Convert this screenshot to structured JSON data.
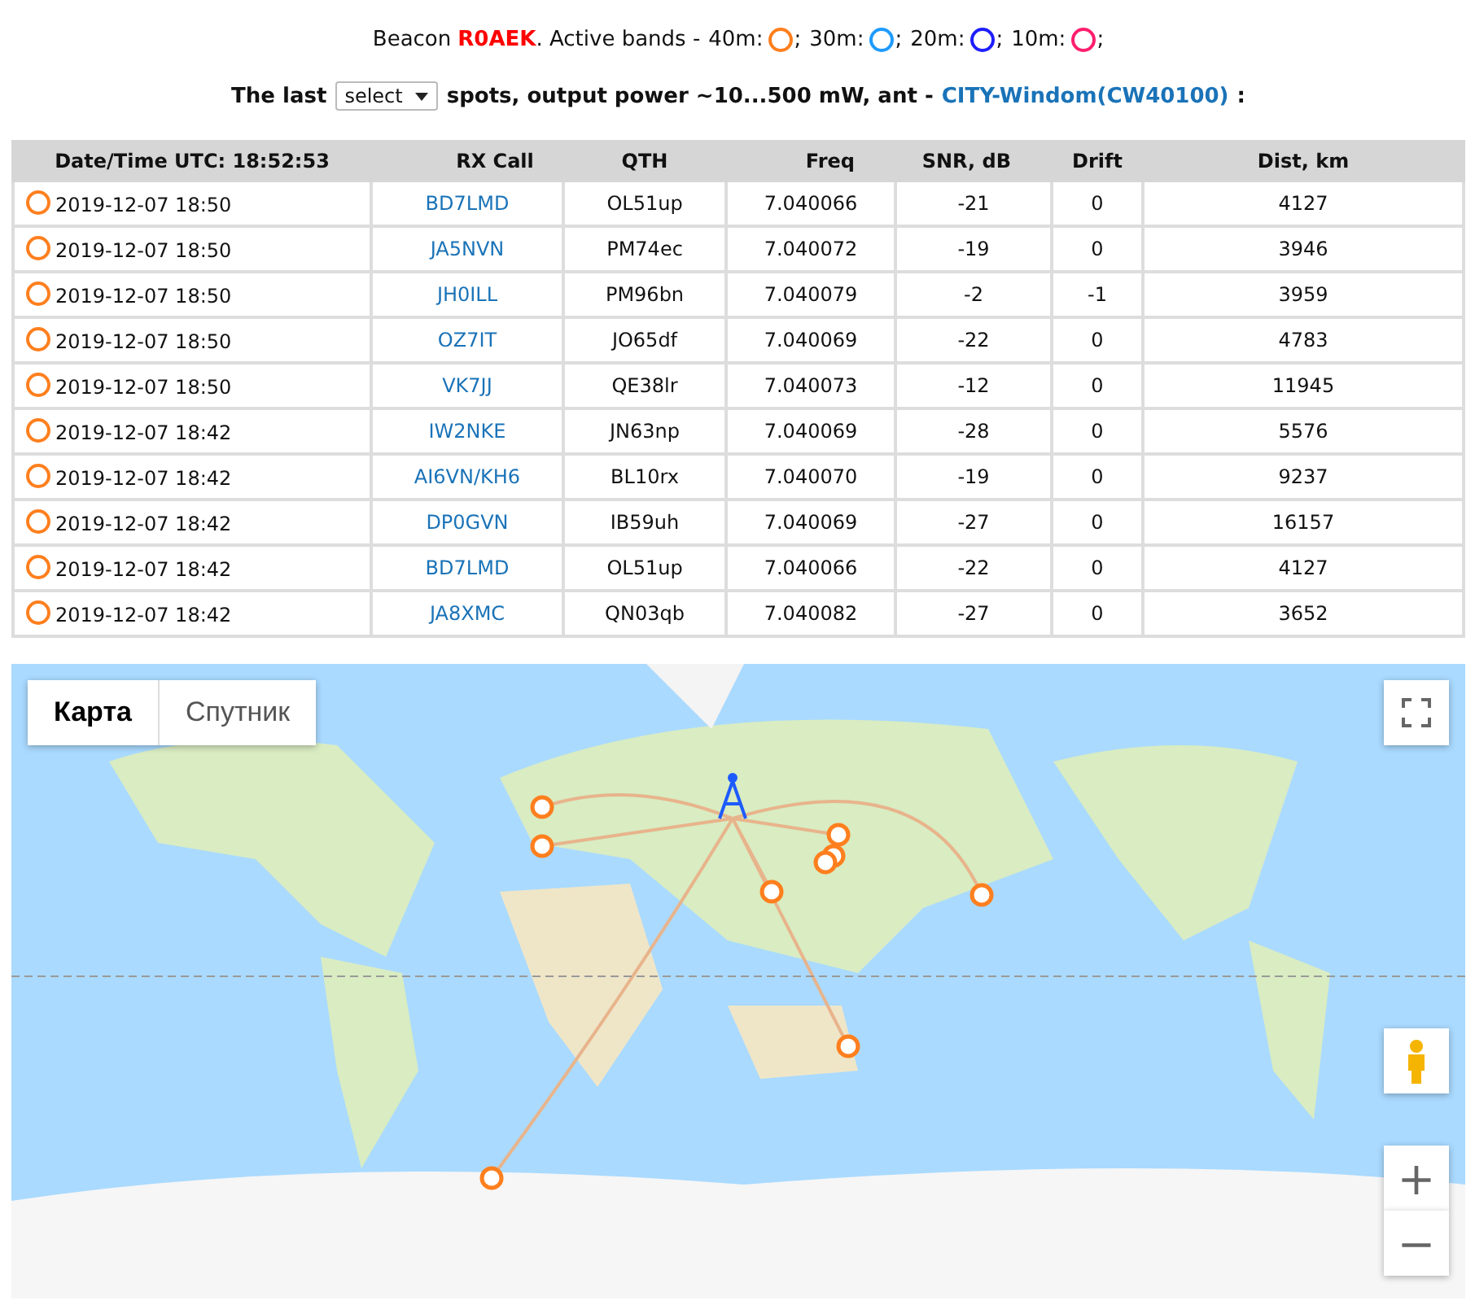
{
  "beacon": {
    "prefix": "Beacon",
    "call": "R0AEK",
    "mid": ". Active bands -"
  },
  "bands": [
    {
      "label": "40m:",
      "color": "#ff7f1e",
      "sep": ";"
    },
    {
      "label": "30m:",
      "color": "#1e9bff",
      "sep": ";"
    },
    {
      "label": "20m:",
      "color": "#1e1eff",
      "sep": ";"
    },
    {
      "label": "10m:",
      "color": "#ff1e6e",
      "sep": ";"
    }
  ],
  "spots_line": {
    "before": "The last",
    "select": "select",
    "after": "spots, output power ~10...500 mW, ant -",
    "antenna": "CITY-Windom(CW40100)",
    "end": ":"
  },
  "table": {
    "columns": [
      "Date/Time UTC: 18:52:53",
      "RX Call",
      "QTH",
      "Freq",
      "SNR, dB",
      "Drift",
      "Dist, km"
    ],
    "rows": [
      {
        "color": "#ff7f1e",
        "time": "2019-12-07 18:50",
        "call": "BD7LMD",
        "qth": "OL51up",
        "freq": "7.040066",
        "snr": "-21",
        "drift": "0",
        "dist": "4127"
      },
      {
        "color": "#ff7f1e",
        "time": "2019-12-07 18:50",
        "call": "JA5NVN",
        "qth": "PM74ec",
        "freq": "7.040072",
        "snr": "-19",
        "drift": "0",
        "dist": "3946"
      },
      {
        "color": "#ff7f1e",
        "time": "2019-12-07 18:50",
        "call": "JH0ILL",
        "qth": "PM96bn",
        "freq": "7.040079",
        "snr": "-2",
        "drift": "-1",
        "dist": "3959"
      },
      {
        "color": "#ff7f1e",
        "time": "2019-12-07 18:50",
        "call": "OZ7IT",
        "qth": "JO65df",
        "freq": "7.040069",
        "snr": "-22",
        "drift": "0",
        "dist": "4783"
      },
      {
        "color": "#ff7f1e",
        "time": "2019-12-07 18:50",
        "call": "VK7JJ",
        "qth": "QE38lr",
        "freq": "7.040073",
        "snr": "-12",
        "drift": "0",
        "dist": "11945"
      },
      {
        "color": "#ff7f1e",
        "time": "2019-12-07 18:42",
        "call": "IW2NKE",
        "qth": "JN63np",
        "freq": "7.040069",
        "snr": "-28",
        "drift": "0",
        "dist": "5576"
      },
      {
        "color": "#ff7f1e",
        "time": "2019-12-07 18:42",
        "call": "AI6VN/KH6",
        "qth": "BL10rx",
        "freq": "7.040070",
        "snr": "-19",
        "drift": "0",
        "dist": "9237"
      },
      {
        "color": "#ff7f1e",
        "time": "2019-12-07 18:42",
        "call": "DP0GVN",
        "qth": "IB59uh",
        "freq": "7.040069",
        "snr": "-27",
        "drift": "0",
        "dist": "16157"
      },
      {
        "color": "#ff7f1e",
        "time": "2019-12-07 18:42",
        "call": "BD7LMD",
        "qth": "OL51up",
        "freq": "7.040066",
        "snr": "-22",
        "drift": "0",
        "dist": "4127"
      },
      {
        "color": "#ff7f1e",
        "time": "2019-12-07 18:42",
        "call": "JA8XMC",
        "qth": "QN03qb",
        "freq": "7.040082",
        "snr": "-27",
        "drift": "0",
        "dist": "3652"
      }
    ]
  },
  "map": {
    "kind": "picture",
    "map_types": [
      {
        "label": "Карта",
        "selected": true
      },
      {
        "label": "Спутник",
        "selected": false
      }
    ],
    "zoom_in": "+",
    "zoom_out": "−"
  }
}
